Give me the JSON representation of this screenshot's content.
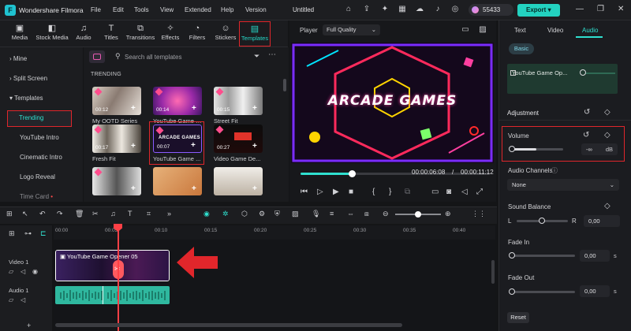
{
  "app": {
    "name": "Wondershare Filmora",
    "document_title": "Untitled",
    "credits": "55433",
    "export_label": "Export"
  },
  "menu": [
    "File",
    "Edit",
    "Tools",
    "View",
    "Extended",
    "Help",
    "Version"
  ],
  "top_tabs": [
    {
      "label": "Media",
      "icon": "media-icon"
    },
    {
      "label": "Stock Media",
      "icon": "stock-media-icon"
    },
    {
      "label": "Audio",
      "icon": "audio-icon"
    },
    {
      "label": "Titles",
      "icon": "titles-icon"
    },
    {
      "label": "Transitions",
      "icon": "transitions-icon"
    },
    {
      "label": "Effects",
      "icon": "effects-icon"
    },
    {
      "label": "Filters",
      "icon": "filters-icon"
    },
    {
      "label": "Stickers",
      "icon": "stickers-icon"
    },
    {
      "label": "Templates",
      "icon": "templates-icon",
      "active": true
    }
  ],
  "sidebar": [
    {
      "label": "Mine"
    },
    {
      "label": "Split Screen"
    },
    {
      "label": "Templates"
    },
    {
      "label": "Trending",
      "selected": true
    },
    {
      "label": "YouTube Intro"
    },
    {
      "label": "Cinematic Intro"
    },
    {
      "label": "Logo Reveal"
    },
    {
      "label": "Time Card"
    }
  ],
  "search": {
    "placeholder": "Search all templates"
  },
  "section_heading": "TRENDING",
  "templates": [
    {
      "name": "My OOTD Series",
      "duration": "00:12"
    },
    {
      "name": "YouTube Game Op...",
      "duration": "00:14"
    },
    {
      "name": "Street Fit",
      "duration": "00:15"
    },
    {
      "name": "Fresh Fit",
      "duration": "00:17"
    },
    {
      "name": "YouTube Game ...",
      "duration": "00:07",
      "selected": true
    },
    {
      "name": "Video Game De...",
      "duration": "00:27"
    },
    {
      "name": "",
      "duration": ""
    },
    {
      "name": "",
      "duration": ""
    },
    {
      "name": "",
      "duration": ""
    }
  ],
  "player": {
    "label": "Player",
    "quality": "Full Quality",
    "preview_title": "ARCADE GAMES",
    "current_time": "00:00:06:08",
    "separator": "/",
    "total_time": "00:00:11:12",
    "progress": 0.27
  },
  "right_panel": {
    "tabs": [
      "Text",
      "Video",
      "Audio"
    ],
    "active_tab": "Audio",
    "basic_label": "Basic",
    "clip_name": "YouTube Game Op...",
    "adjustment": "Adjustment",
    "volume": {
      "label": "Volume",
      "value": "-∞",
      "unit": "dB",
      "level": 0.5
    },
    "audio_channels": {
      "label": "Audio Channels",
      "value": "None"
    },
    "sound_balance": {
      "label": "Sound Balance",
      "left": "L",
      "right": "R",
      "value": "0,00",
      "level": 0.5
    },
    "fade_in": {
      "label": "Fade In",
      "value": "0,00",
      "unit": "s",
      "level": 0
    },
    "fade_out": {
      "label": "Fade Out",
      "value": "0,00",
      "unit": "s",
      "level": 0
    },
    "reset_label": "Reset"
  },
  "timeline": {
    "ticks": [
      "00:00",
      "00:05",
      "00:10",
      "00:15",
      "00:20",
      "00:25",
      "00:30",
      "00:35",
      "00:40"
    ],
    "video_track_label": "Video 1",
    "audio_track_label": "Audio 1",
    "video_clip_name": "YouTube Game Opener 05",
    "audio_clip_segments": [
      "",
      ""
    ]
  },
  "colors": {
    "accent": "#27d8c8",
    "highlight": "#e0262b",
    "playhead": "#ff4046",
    "audio_clip": "#2fb89f"
  }
}
